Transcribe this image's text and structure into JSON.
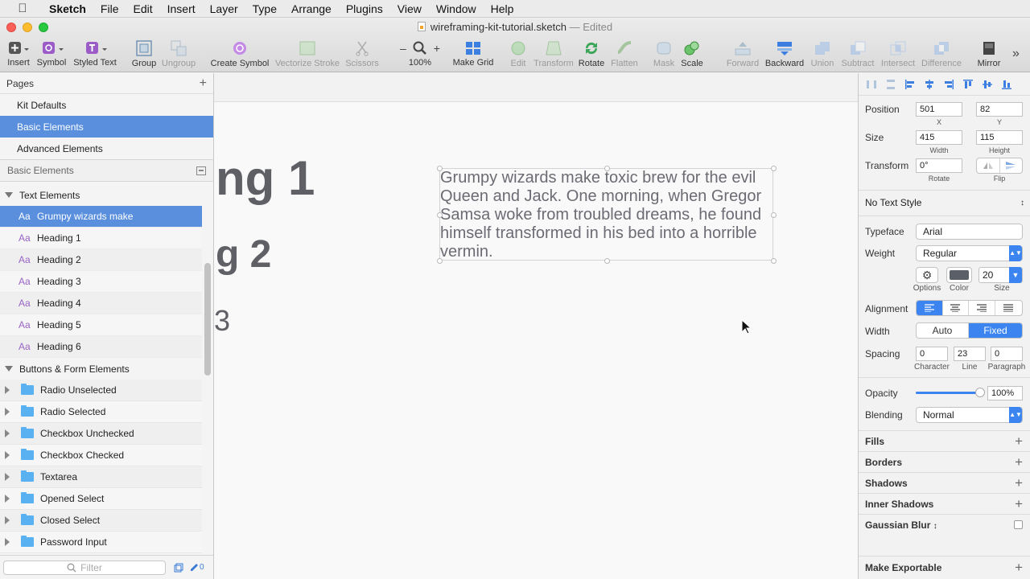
{
  "menubar": {
    "items": [
      "Sketch",
      "File",
      "Edit",
      "Insert",
      "Layer",
      "Type",
      "Arrange",
      "Plugins",
      "View",
      "Window",
      "Help"
    ]
  },
  "window": {
    "filename": "wireframing-kit-tutorial.sketch",
    "status": "— Edited"
  },
  "toolbar": {
    "insert": "Insert",
    "symbol": "Symbol",
    "styled_text": "Styled Text",
    "group": "Group",
    "ungroup": "Ungroup",
    "create_symbol": "Create Symbol",
    "vectorize_stroke": "Vectorize Stroke",
    "scissors": "Scissors",
    "zoom_minus": "–",
    "zoom_plus": "+",
    "zoom_level": "100%",
    "make_grid": "Make Grid",
    "edit": "Edit",
    "transform": "Transform",
    "rotate": "Rotate",
    "flatten": "Flatten",
    "mask": "Mask",
    "scale": "Scale",
    "forward": "Forward",
    "backward": "Backward",
    "union": "Union",
    "subtract": "Subtract",
    "intersect": "Intersect",
    "difference": "Difference",
    "mirror": "Mirror"
  },
  "sidebar": {
    "pages_title": "Pages",
    "pages": [
      "Kit Defaults",
      "Basic Elements",
      "Advanced Elements"
    ],
    "selected_page": "Basic Elements",
    "layers_title": "Basic Elements",
    "group1": "Text Elements",
    "text_layers": [
      "Grumpy wizards make",
      "Heading 1",
      "Heading 2",
      "Heading 3",
      "Heading 4",
      "Heading 5",
      "Heading 6"
    ],
    "text_glyph": "Aa",
    "group2": "Buttons & Form Elements",
    "form_layers": [
      "Radio Unselected",
      "Radio Selected",
      "Checkbox Unchecked",
      "Checkbox Checked",
      "Textarea",
      "Opened Select",
      "Closed Select",
      "Password Input"
    ],
    "filter_placeholder": "Filter",
    "filter_count": "0"
  },
  "canvas": {
    "heading1": "ng 1",
    "heading2": "g 2",
    "heading3": "3",
    "body_text": "Grumpy wizards make toxic brew for the evil Queen and Jack. One morning, when Gregor Samsa woke from troubled dreams, he found himself transformed in his bed into a horrible vermin."
  },
  "inspector": {
    "position_label": "Position",
    "x": "501",
    "x_label": "X",
    "y": "82",
    "y_label": "Y",
    "size_label": "Size",
    "width": "415",
    "width_label": "Width",
    "height": "115",
    "height_label": "Height",
    "transform_label": "Transform",
    "rotate": "0°",
    "rotate_label": "Rotate",
    "flip_label": "Flip",
    "text_style": "No Text Style",
    "typeface_label": "Typeface",
    "typeface": "Arial",
    "weight_label": "Weight",
    "weight": "Regular",
    "options_label": "Options",
    "color_label": "Color",
    "size_sub": "Size",
    "font_size": "20",
    "color_hex": "#5b5f68",
    "alignment_label": "Alignment",
    "width_mode_label": "Width",
    "auto": "Auto",
    "fixed": "Fixed",
    "spacing_label": "Spacing",
    "character": "0",
    "character_label": "Character",
    "line": "23",
    "line_label": "Line",
    "paragraph": "0",
    "paragraph_label": "Paragraph",
    "opacity_label": "Opacity",
    "opacity": "100%",
    "opacity_value": 1.0,
    "blending_label": "Blending",
    "blending": "Normal",
    "fills": "Fills",
    "borders": "Borders",
    "shadows": "Shadows",
    "inner_shadows": "Inner Shadows",
    "gaussian_blur": "Gaussian Blur",
    "make_exportable": "Make Exportable"
  },
  "colors": {
    "selection": "#5a8fde",
    "accent": "#3c85f0"
  }
}
